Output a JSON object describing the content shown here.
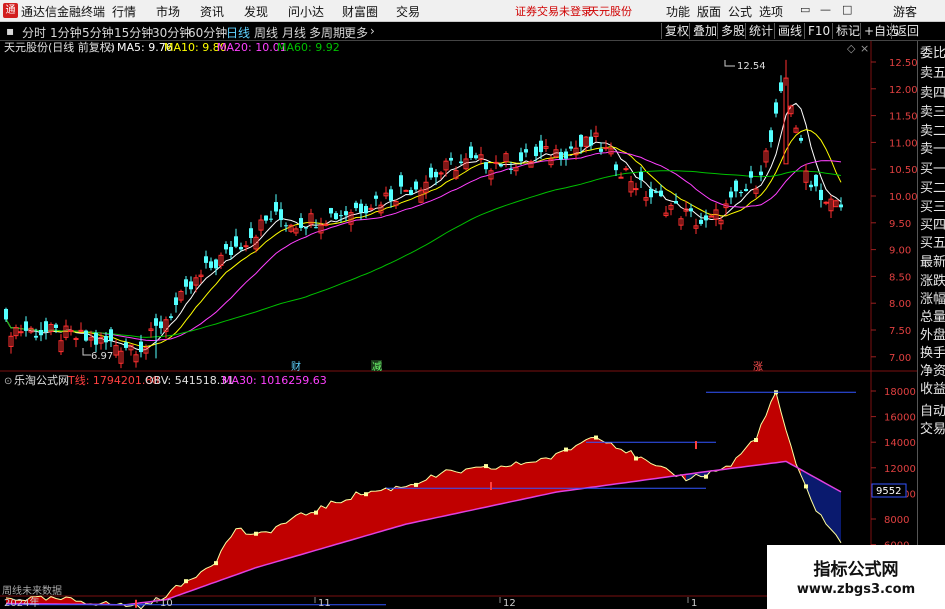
{
  "menubar": {
    "app_title": "通达信金融终端",
    "items": [
      "行情",
      "市场",
      "资讯",
      "发现",
      "问小达",
      "财富圈",
      "交易"
    ],
    "notice": [
      "证券交易未登录",
      "天元股份"
    ],
    "right_items": [
      "功能",
      "版面",
      "公式",
      "选项"
    ],
    "guest": "游客"
  },
  "toolbar": {
    "periods": [
      "分时",
      "1分钟",
      "5分钟",
      "15分钟",
      "30分钟",
      "60分钟",
      "日线",
      "周线",
      "月线",
      "多周期",
      "更多"
    ],
    "active_period": "日线",
    "right_tools": [
      "复权",
      "叠加",
      "多股",
      "统计",
      "画线",
      "F10",
      "标记",
      "+自选",
      "返回"
    ]
  },
  "main_chart": {
    "stock_label": "天元股份(日线 前复权)",
    "ma5": "MA5: 9.76",
    "ma10": "MA10: 9.80",
    "ma20": "MA20: 10.01",
    "ma60": "MA60: 9.92",
    "high_marker": "12.54",
    "low_marker": "6.97",
    "event_markers": [
      "财",
      "减",
      "涨"
    ],
    "price_ticks": [
      "12.50",
      "12.00",
      "11.50",
      "11.00",
      "10.50",
      "10.00",
      "9.50",
      "9.00",
      "8.50",
      "8.00",
      "7.50",
      "7.00"
    ],
    "colors": {
      "up": "#ff3030",
      "down": "#54ffff",
      "ma5": "#ffffff",
      "ma10": "#ffff00",
      "ma20": "#ff40ff",
      "ma60": "#00c000"
    }
  },
  "sub_chart": {
    "formula_label": "乐淘公式网",
    "t_line": "T线: 1794201.88",
    "obv": "OBV: 541518.31",
    "ma30": "MA30: 1016259.63",
    "ticks": [
      "18000",
      "16000",
      "14000",
      "12000",
      "10000",
      "8000",
      "6000"
    ],
    "current_value": "9552",
    "bottom_left_text": "周线未来数据",
    "colors": {
      "fill_up": "#c00000",
      "fill_down": "#0a1a6e",
      "ma": "#e040e0",
      "resistance": "#3355ff"
    }
  },
  "time_axis": [
    "2024年",
    "10",
    "11",
    "12",
    "1"
  ],
  "side_panel": {
    "items": [
      "委比",
      "卖五",
      "卖四",
      "卖三",
      "卖二",
      "卖一",
      "买一",
      "买二",
      "买三",
      "买四",
      "买五",
      "最新",
      "涨跌",
      "涨幅",
      "总量",
      "外盘",
      "换手",
      "净资",
      "收益",
      "自动",
      "交易"
    ]
  },
  "watermark": {
    "line1": "指标公式网",
    "line2": "www.zbgs3.com"
  }
}
